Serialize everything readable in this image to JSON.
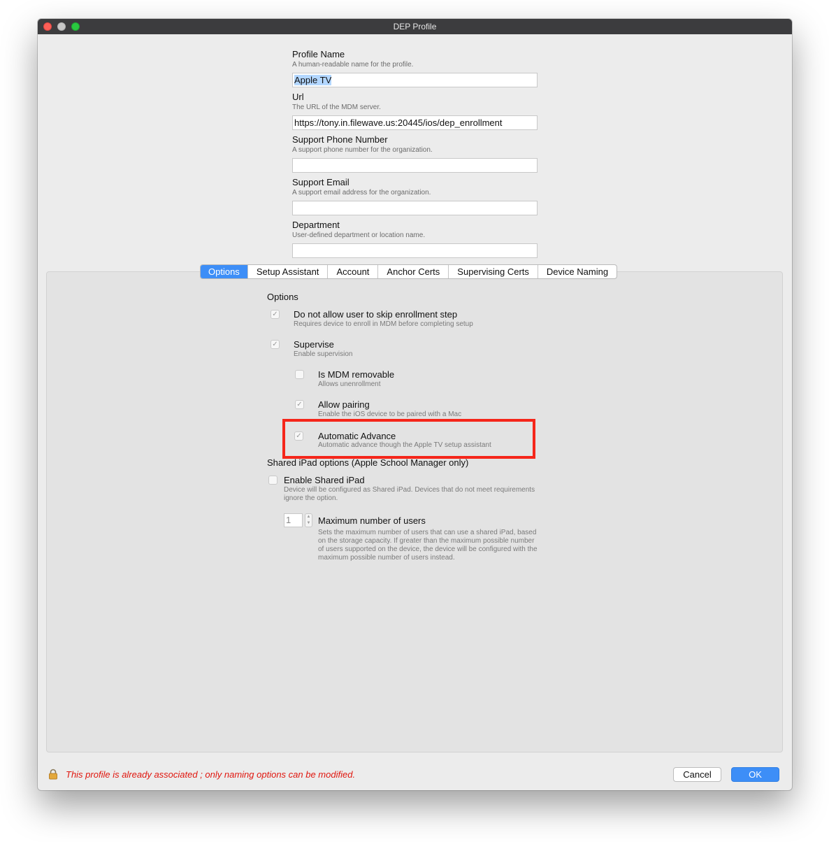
{
  "window": {
    "title": "DEP Profile"
  },
  "fields": [
    {
      "label": "Profile Name",
      "help": "A human-readable name for the profile.",
      "value": "Apple TV"
    },
    {
      "label": "Url",
      "help": "The URL of the MDM server.",
      "value": "https://tony.in.filewave.us:20445/ios/dep_enrollment"
    },
    {
      "label": "Support Phone Number",
      "help": "A support phone number for the organization.",
      "value": ""
    },
    {
      "label": "Support Email",
      "help": "A support email address for the organization.",
      "value": ""
    },
    {
      "label": "Department",
      "help": "User-defined department or location name.",
      "value": ""
    }
  ],
  "tabs": [
    "Options",
    "Setup Assistant",
    "Account",
    "Anchor Certs",
    "Supervising Certs",
    "Device Naming"
  ],
  "active_tab": "Options",
  "options": {
    "section_title": "Options",
    "items": [
      {
        "label": "Do not allow user to skip enrollment step",
        "help": "Requires device to enroll in MDM before completing setup",
        "checked": true
      },
      {
        "label": "Supervise",
        "help": "Enable supervision",
        "checked": true
      },
      {
        "label": "Is MDM removable",
        "help": "Allows unenrollment",
        "checked": false
      },
      {
        "label": "Allow pairing",
        "help": "Enable the iOS device to be paired with a Mac",
        "checked": true
      },
      {
        "label": "Automatic Advance",
        "help": "Automatic advance though the Apple TV setup assistant",
        "checked": true
      }
    ],
    "highlight_color": "#f5261a"
  },
  "shared_ipad": {
    "section_title": "Shared iPad options (Apple School Manager only)",
    "enable_label": "Enable Shared iPad",
    "enable_help_1": "Device will be configured as Shared iPad. Devices that do not meet requirements",
    "enable_help_2": "ignore the option.",
    "enabled": false,
    "max_users_value": "1",
    "max_users_label": "Maximum number of users",
    "max_users_help_1": "Sets the maximum number of users that can use a shared iPad, based",
    "max_users_help_2": "on the storage capacity. If greater than the maximum possible number",
    "max_users_help_3": "of users supported on the device, the device will be configured with the",
    "max_users_help_4": "maximum possible number of users instead."
  },
  "footer": {
    "status_message": "This profile is already associated ; only naming options can be modified.",
    "status_icon": "lock-icon",
    "cancel_label": "Cancel",
    "ok_label": "OK"
  },
  "colors": {
    "accent": "#3d8ef7",
    "status_text": "#e0160e"
  }
}
